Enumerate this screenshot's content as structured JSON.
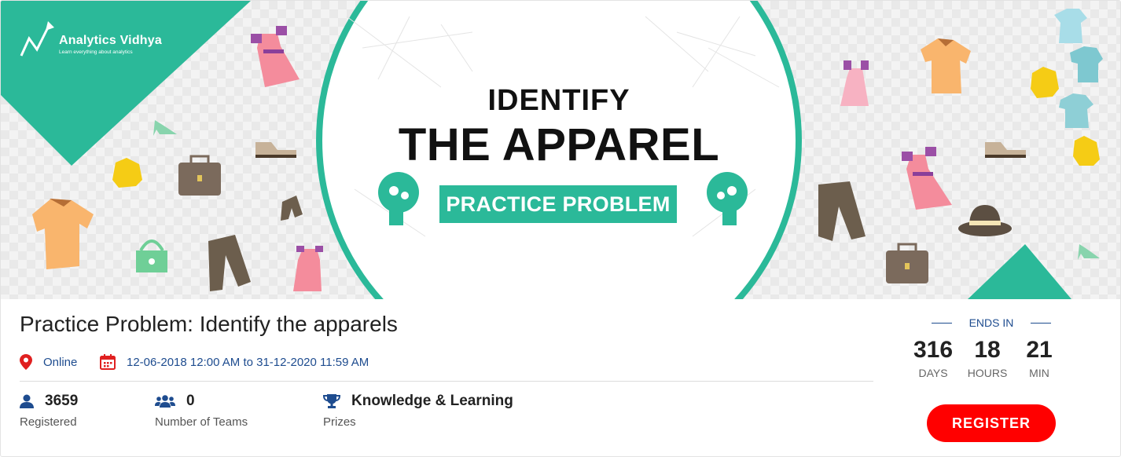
{
  "banner": {
    "brand": {
      "name": "Analytics Vidhya",
      "tagline": "Learn everything about analytics"
    },
    "headline_small": "IDENTIFY",
    "headline_big": "THE APPAREL",
    "pill": "PRACTICE PROBLEM"
  },
  "event": {
    "title": "Practice Problem: Identify the apparels",
    "location": "Online",
    "dates": "12-06-2018 12:00 AM to 31-12-2020 11:59 AM"
  },
  "stats": [
    {
      "value": "3659",
      "label": "Registered",
      "icon": "user-icon"
    },
    {
      "value": "0",
      "label": "Number of Teams",
      "icon": "team-icon"
    },
    {
      "value": "Knowledge & Learning",
      "label": "Prizes",
      "icon": "trophy-icon"
    }
  ],
  "countdown": {
    "heading": "ENDS IN",
    "days": "316",
    "days_label": "DAYS",
    "hours": "18",
    "hours_label": "HOURS",
    "min": "21",
    "min_label": "MIN"
  },
  "register_label": "REGISTER",
  "colors": {
    "teal": "#2bb999",
    "link_blue": "#1e4c8f",
    "register_red": "#ff0000",
    "pin_red": "#e02020"
  }
}
